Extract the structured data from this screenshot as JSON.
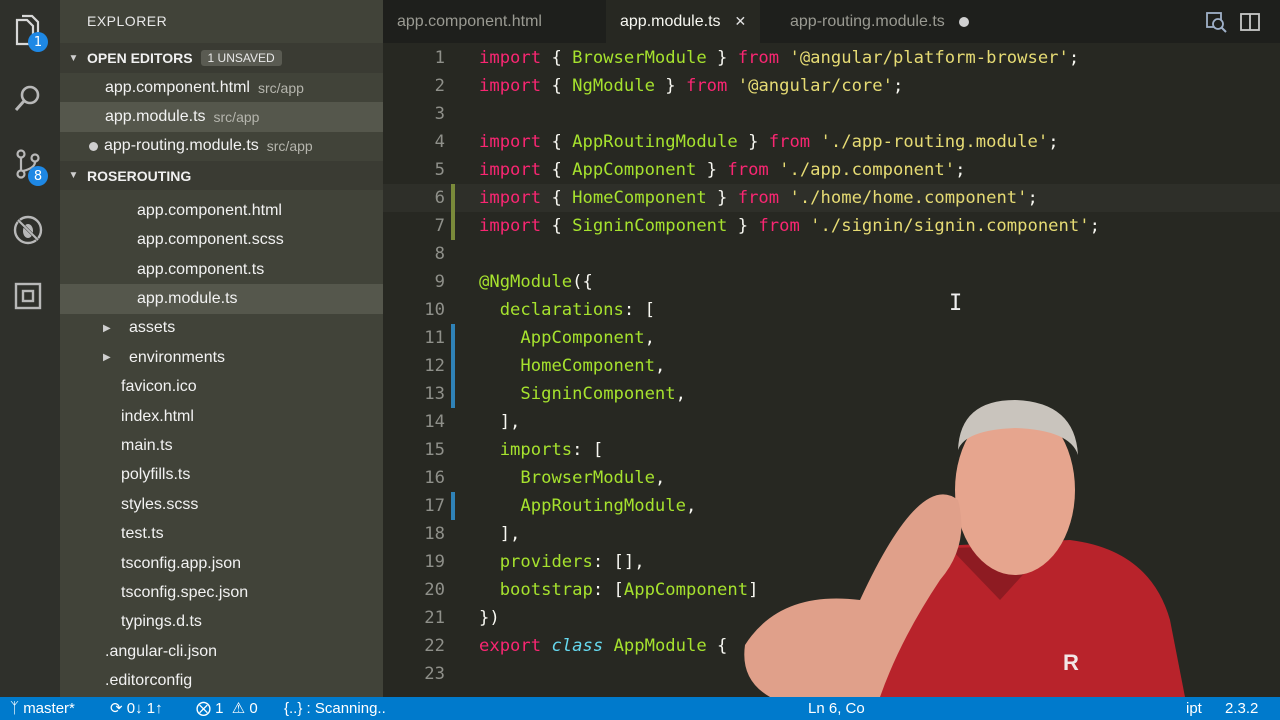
{
  "explorer": {
    "title": "EXPLORER",
    "open_editors": {
      "label": "OPEN EDITORS",
      "unsaved_badge": "1 UNSAVED",
      "items": [
        {
          "name": "app.component.html",
          "path": "src/app"
        },
        {
          "name": "app.module.ts",
          "path": "src/app"
        },
        {
          "name": "app-routing.module.ts",
          "path": "src/app"
        }
      ]
    },
    "project": {
      "label": "ROSEROUTING",
      "files": [
        "app.component.html",
        "app.component.scss",
        "app.component.ts",
        "app.module.ts"
      ],
      "folders": [
        "assets",
        "environments"
      ],
      "src_files": [
        "favicon.ico",
        "index.html",
        "main.ts",
        "polyfills.ts",
        "styles.scss",
        "test.ts",
        "tsconfig.app.json",
        "tsconfig.spec.json",
        "typings.d.ts"
      ],
      "root_files": [
        ".angular-cli.json",
        ".editorconfig"
      ]
    }
  },
  "activity_bar": {
    "explorer_badge": "1",
    "scm_badge": "8",
    "icons": [
      "files-icon",
      "search-icon",
      "source-control-icon",
      "debug-icon",
      "extensions-icon"
    ]
  },
  "tabs": [
    {
      "label": "app.component.html",
      "state": "inactive"
    },
    {
      "label": "app.module.ts",
      "state": "active"
    },
    {
      "label": "app-routing.module.ts",
      "state": "modified"
    }
  ],
  "editor": {
    "line_numbers": [
      "1",
      "2",
      "3",
      "4",
      "5",
      "6",
      "7",
      "8",
      "9",
      "10",
      "11",
      "12",
      "13",
      "14",
      "15",
      "16",
      "17",
      "18",
      "19",
      "20",
      "21",
      "22",
      "23"
    ],
    "lines": [
      "import { BrowserModule } from '@angular/platform-browser';",
      "import { NgModule } from '@angular/core';",
      "",
      "import { AppRoutingModule } from './app-routing.module';",
      "import { AppComponent } from './app.component';",
      "import { HomeComponent } from './home/home.component';",
      "import { SigninComponent } from './signin/signin.component';",
      "",
      "@NgModule({",
      "  declarations: [",
      "    AppComponent,",
      "    HomeComponent,",
      "    SigninComponent,",
      "  ],",
      "  imports: [",
      "    BrowserModule,",
      "    AppRoutingModule,",
      "  ],",
      "  providers: [],",
      "  bootstrap: [AppComponent]",
      "})",
      "export class AppModule {",
      ""
    ],
    "current_line": 6
  },
  "status_bar": {
    "branch": "master*",
    "sync": "0↓ 1↑",
    "errors": "1",
    "warnings": "0",
    "scanning": "{..} : Scanning..",
    "cursor": "Ln 6, Co",
    "language_fragment": "ipt",
    "version": "2.3.2"
  },
  "colors": {
    "status_bar": "#007acc",
    "sidebar": "#414339",
    "editor_bg": "#272822",
    "keyword": "#f92672",
    "string": "#e6db74",
    "identifier": "#a6e22e"
  }
}
